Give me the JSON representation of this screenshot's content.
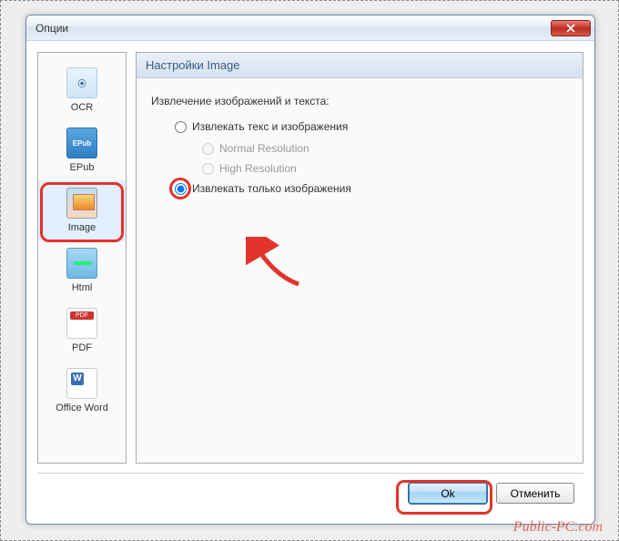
{
  "titlebar": {
    "title": "Опции"
  },
  "sidebar": {
    "items": [
      {
        "label": "OCR"
      },
      {
        "label": "EPub"
      },
      {
        "label": "Image"
      },
      {
        "label": "Html"
      },
      {
        "label": "PDF"
      },
      {
        "label": "Office Word"
      }
    ]
  },
  "panel": {
    "header": "Настройки Image",
    "section_title": "Извлечение изображений и текста:",
    "options": {
      "opt1": "Извлекать текс и изображения",
      "sub1": "Normal Resolution",
      "sub2": "High Resolution",
      "opt2": "Извлекать только изображения"
    }
  },
  "buttons": {
    "ok": "Ok",
    "cancel": "Отменить"
  },
  "watermark": "Public-PC.com"
}
